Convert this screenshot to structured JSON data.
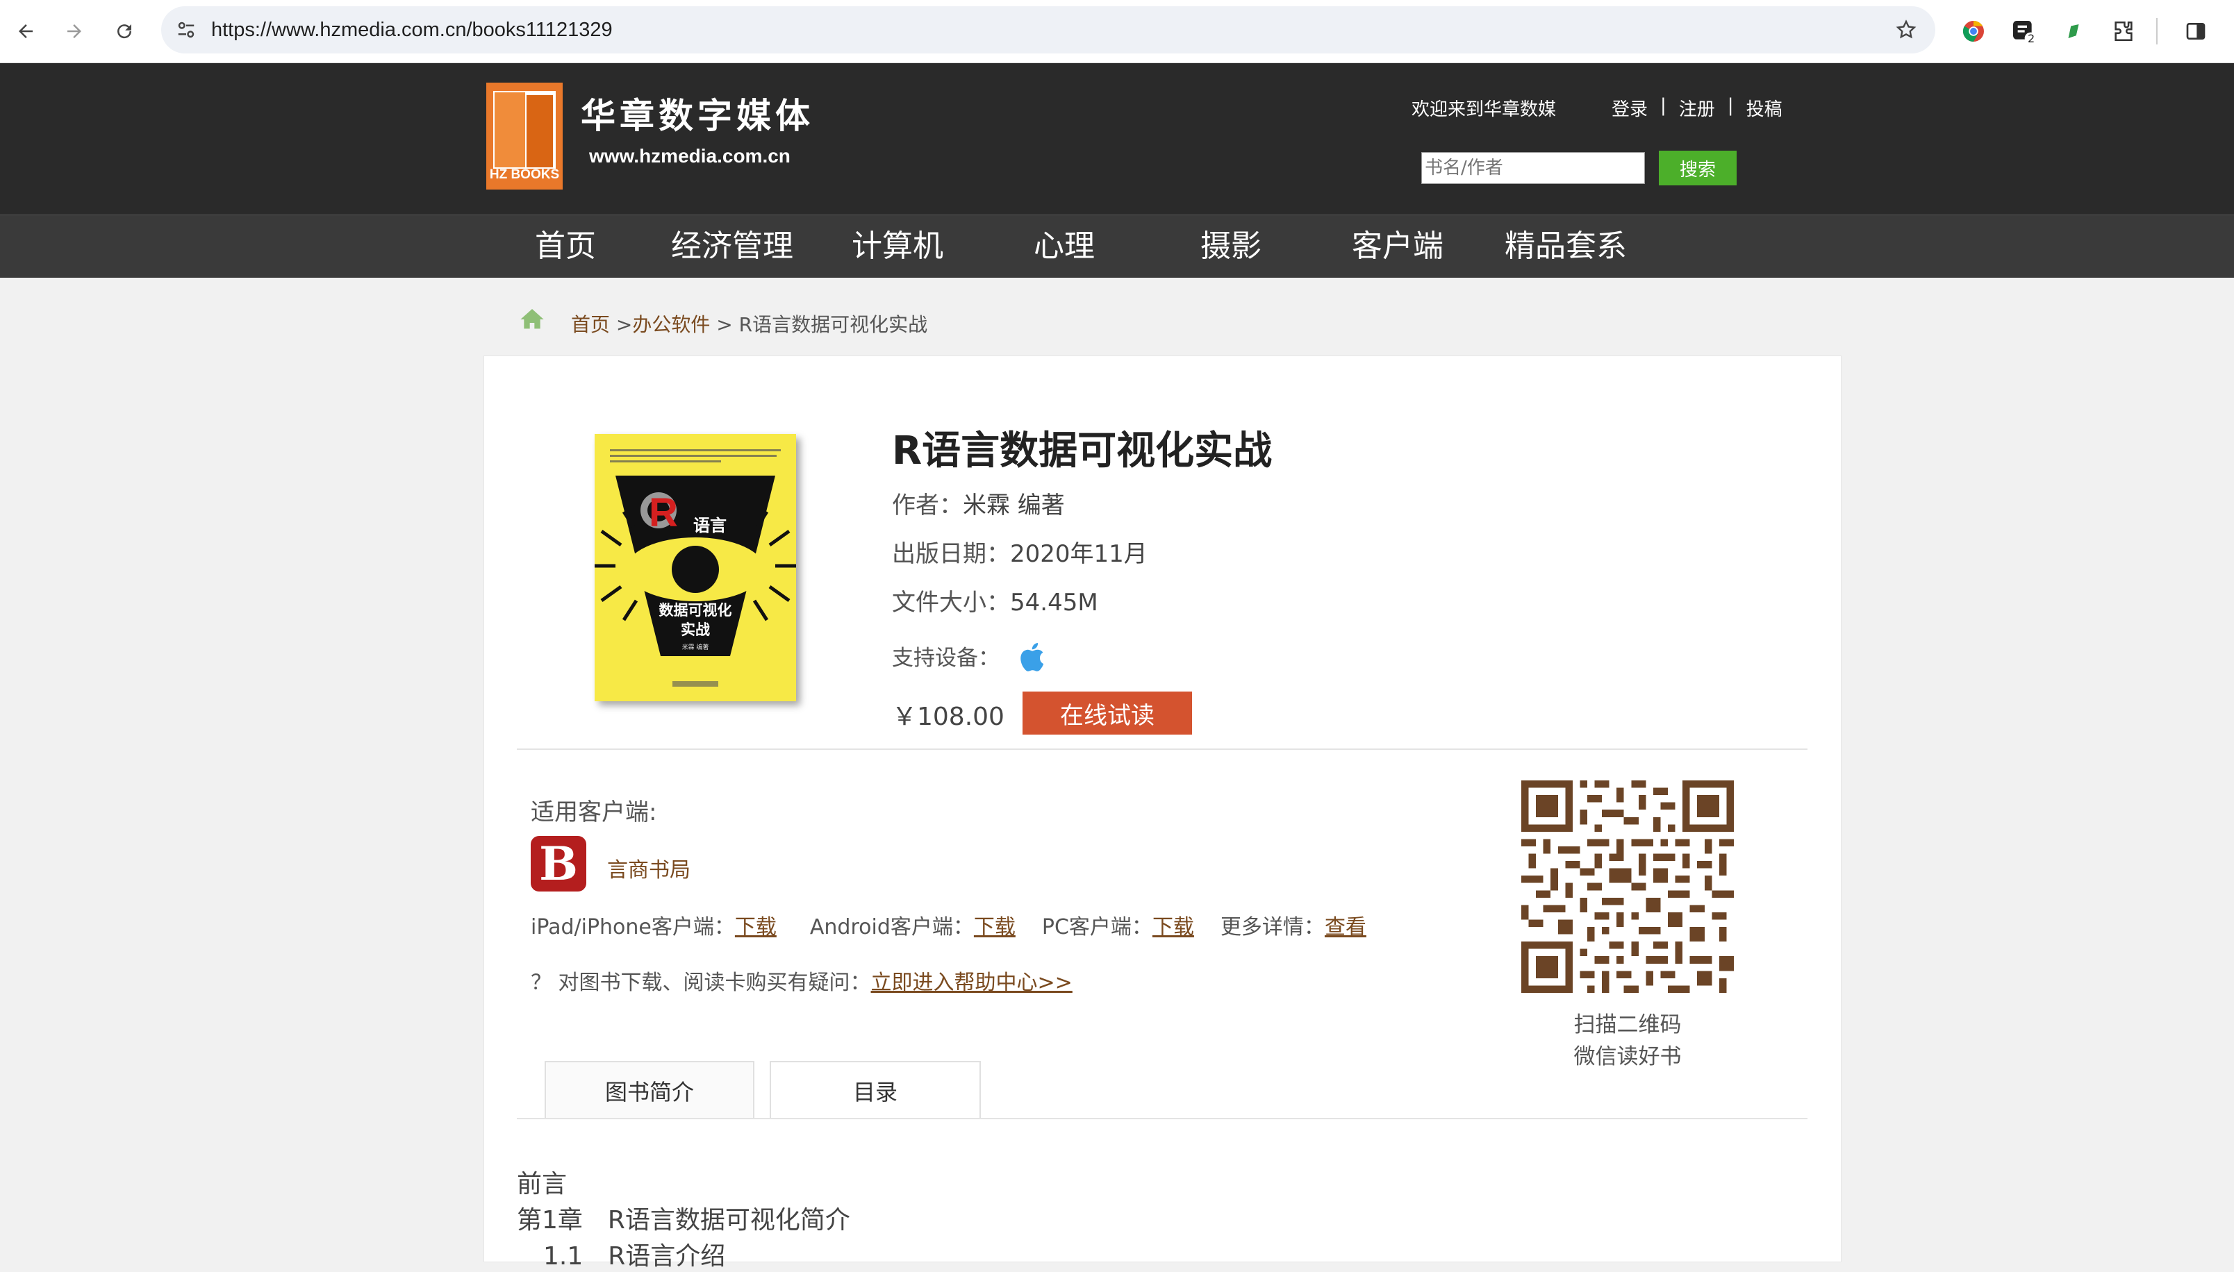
{
  "browser": {
    "url": "https://www.hzmedia.com.cn/books11121329",
    "extension_badge": "2"
  },
  "header": {
    "logo_title": "华章数字媒体",
    "logo_url": "www.hzmedia.com.cn",
    "logo_badge": "HZ BOOKS",
    "welcome": "欢迎来到华章数媒",
    "links": [
      "登录",
      "注册",
      "投稿"
    ],
    "search_placeholder": "书名/作者",
    "search_button": "搜索"
  },
  "nav": {
    "items": [
      "首页",
      "经济管理",
      "计算机",
      "心理",
      "摄影",
      "客户端",
      "精品套系"
    ]
  },
  "breadcrumb": {
    "home": "首页",
    "sep1": " >",
    "category": "办公软件",
    "sep2": " > ",
    "current": "R语言数据可视化实战"
  },
  "book": {
    "title": "R语言数据可视化实战",
    "author_label": "作者：",
    "author": "米霖 编著",
    "date_label": "出版日期：",
    "date": "2020年11月",
    "size_label": "文件大小：",
    "size": "54.45M",
    "device_label": "支持设备：",
    "device_icon": "apple-icon",
    "price": "￥108.00",
    "read_button": "在线试读",
    "cover": {
      "r_letter": "R",
      "lang": "语言",
      "line1": "数据可视化",
      "line2": "实战",
      "author": "米霖 编著",
      "bg_color": "#f7e946"
    }
  },
  "clients": {
    "label": "适用客户端:",
    "app_logo": "B",
    "app_name": "言商书局",
    "ipad_label": "iPad/iPhone客户端：",
    "ipad_link": "下载",
    "android_label": "Android客户端：",
    "android_link": "下载",
    "pc_label": "PC客户端：",
    "pc_link": "下载",
    "more_label": "更多详情：",
    "more_link": "查看",
    "help_prefix": "？ 对图书下载、阅读卡购买有疑问：",
    "help_link": "立即进入帮助中心>>"
  },
  "qr": {
    "caption1": "扫描二维码",
    "caption2": "微信读好书"
  },
  "tabs": [
    "图书简介",
    "目录"
  ],
  "toc": [
    "前言",
    "第1章　R语言数据可视化简介",
    "1.1　R语言介绍"
  ],
  "colors": {
    "header_bg": "#2a2a2a",
    "accent_brown": "#7a4a1f",
    "button_red": "#d4532f",
    "search_green": "#4caf2a",
    "logo_orange": "#e9782a"
  }
}
